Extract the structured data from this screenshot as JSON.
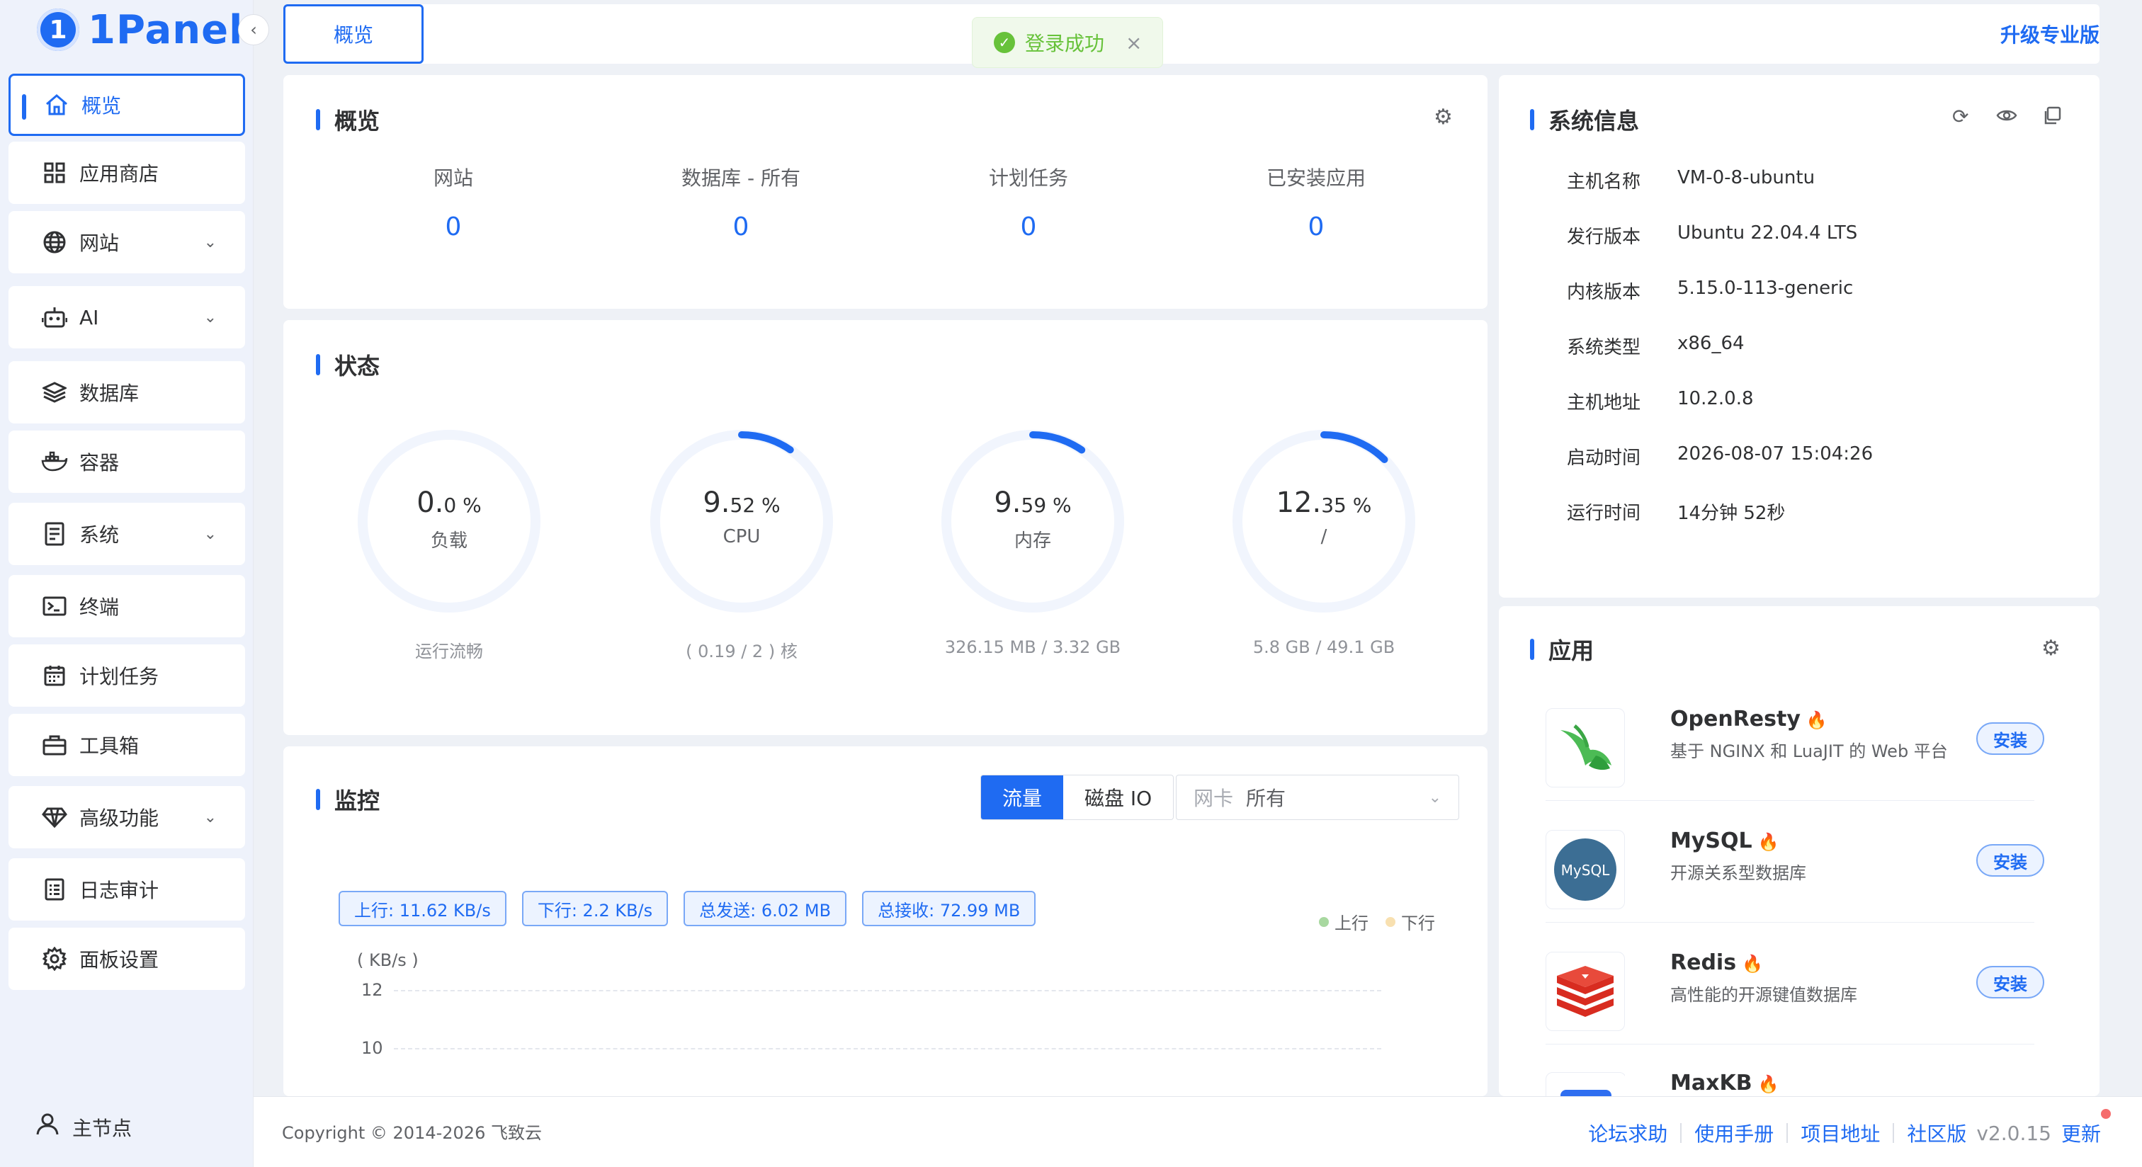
{
  "logo": {
    "text": "1Panel",
    "badge": "1"
  },
  "topbar": {
    "tab": "概览",
    "upgrade": "升级专业版"
  },
  "toast": {
    "text": "登录成功"
  },
  "sidebar": {
    "items": [
      {
        "label": "概览",
        "icon": "home-icon"
      },
      {
        "label": "应用商店",
        "icon": "grid-icon"
      },
      {
        "label": "网站",
        "icon": "globe-icon"
      },
      {
        "label": "AI",
        "icon": "robot-icon"
      },
      {
        "label": "数据库",
        "icon": "layers-icon"
      },
      {
        "label": "容器",
        "icon": "docker-icon"
      },
      {
        "label": "系统",
        "icon": "file-icon"
      },
      {
        "label": "终端",
        "icon": "terminal-icon"
      },
      {
        "label": "计划任务",
        "icon": "calendar-icon"
      },
      {
        "label": "工具箱",
        "icon": "toolbox-icon"
      },
      {
        "label": "高级功能",
        "icon": "diamond-icon"
      },
      {
        "label": "日志审计",
        "icon": "log-icon"
      },
      {
        "label": "面板设置",
        "icon": "gear-icon"
      }
    ],
    "node": "主节点"
  },
  "overview": {
    "title": "概览",
    "stats": [
      {
        "label": "网站",
        "value": "0"
      },
      {
        "label": "数据库 - 所有",
        "value": "0"
      },
      {
        "label": "计划任务",
        "value": "0"
      },
      {
        "label": "已安装应用",
        "value": "0"
      }
    ]
  },
  "status": {
    "title": "状态",
    "gauges": [
      {
        "int": "0.",
        "dec": "0",
        "unit": " %",
        "label": "负载",
        "foot": "运行流畅",
        "percent": 0.0
      },
      {
        "int": "9.",
        "dec": "52",
        "unit": " %",
        "label": "CPU",
        "foot": "( 0.19 / 2 ) 核",
        "percent": 9.52
      },
      {
        "int": "9.",
        "dec": "59",
        "unit": " %",
        "label": "内存",
        "foot": "326.15 MB / 3.32 GB",
        "percent": 9.59
      },
      {
        "int": "12.",
        "dec": "35",
        "unit": " %",
        "label": "/",
        "foot": "5.8 GB / 49.1 GB",
        "percent": 12.35
      }
    ]
  },
  "monitor": {
    "title": "监控",
    "seg_traffic": "流量",
    "seg_disk": "磁盘 IO",
    "select_label": "网卡",
    "select_value": "所有",
    "tags": [
      "上行: 11.62 KB/s",
      "下行: 2.2 KB/s",
      "总发送: 6.02 MB",
      "总接收: 72.99 MB"
    ],
    "legend_up": "上行",
    "legend_down": "下行",
    "y_unit": "( KB/s )",
    "y_ticks": [
      "12",
      "10"
    ],
    "colors": {
      "up": "#a8d8a0",
      "down": "#f8e0b0"
    }
  },
  "sysinfo": {
    "title": "系统信息",
    "rows": [
      {
        "k": "主机名称",
        "v": "VM-0-8-ubuntu"
      },
      {
        "k": "发行版本",
        "v": "Ubuntu 22.04.4 LTS"
      },
      {
        "k": "内核版本",
        "v": "5.15.0-113-generic"
      },
      {
        "k": "系统类型",
        "v": "x86_64"
      },
      {
        "k": "主机地址",
        "v": "10.2.0.8"
      },
      {
        "k": "启动时间",
        "v": "2026-08-07 15:04:26"
      },
      {
        "k": "运行时间",
        "v": "14分钟 52秒"
      }
    ]
  },
  "apps": {
    "title": "应用",
    "items": [
      {
        "name": "OpenResty",
        "desc": "基于 NGINX 和 LuaJIT 的 Web 平台",
        "action": "安装"
      },
      {
        "name": "MySQL",
        "desc": "开源关系型数据库",
        "action": "安装"
      },
      {
        "name": "Redis",
        "desc": "高性能的开源键值数据库",
        "action": "安装"
      },
      {
        "name": "MaxKB",
        "desc": "",
        "action": ""
      }
    ],
    "mysql_logo_text": "MySQL"
  },
  "footer": {
    "copyright": "Copyright © 2014-2026 飞致云",
    "links": [
      "论坛求助",
      "使用手册",
      "项目地址",
      "社区版"
    ],
    "version": "v2.0.15",
    "update": "更新"
  },
  "accent": "#1f6bf2"
}
